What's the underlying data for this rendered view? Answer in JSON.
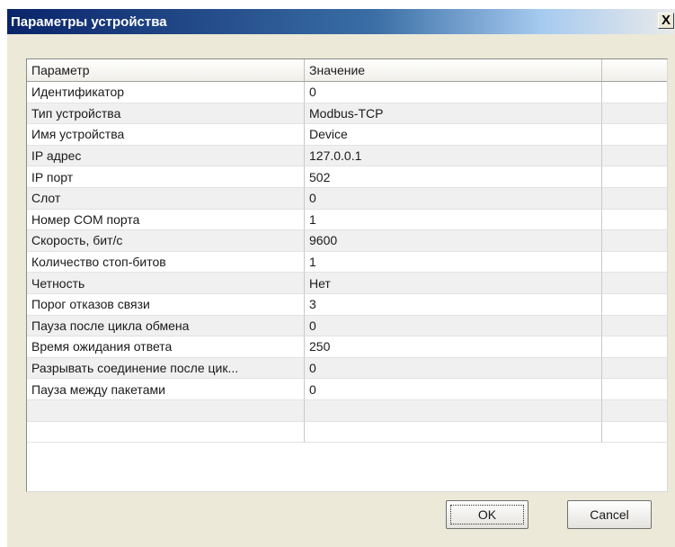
{
  "window": {
    "title": "Параметры устройства",
    "close_label": "X"
  },
  "table": {
    "columns": [
      "Параметр",
      "Значение",
      ""
    ],
    "rows": [
      [
        "Идентификатор",
        "0"
      ],
      [
        "Тип устройства",
        "Modbus-TCP"
      ],
      [
        "Имя устройства",
        "Device"
      ],
      [
        "IP адрес",
        "127.0.0.1"
      ],
      [
        "IP порт",
        "502"
      ],
      [
        "Слот",
        "0"
      ],
      [
        "Номер COM порта",
        "1"
      ],
      [
        "Скорость, бит/с",
        "9600"
      ],
      [
        "Количество стоп-битов",
        "1"
      ],
      [
        "Четность",
        "Нет"
      ],
      [
        "Порог отказов связи",
        "3"
      ],
      [
        "Пауза после цикла обмена",
        "0"
      ],
      [
        "Время ожидания ответа",
        "250"
      ],
      [
        "Разрывать соединение после цик...",
        "0"
      ],
      [
        "Пауза между пакетами",
        "0"
      ]
    ]
  },
  "buttons": {
    "ok_label": "OK",
    "cancel_label": "Cancel"
  }
}
